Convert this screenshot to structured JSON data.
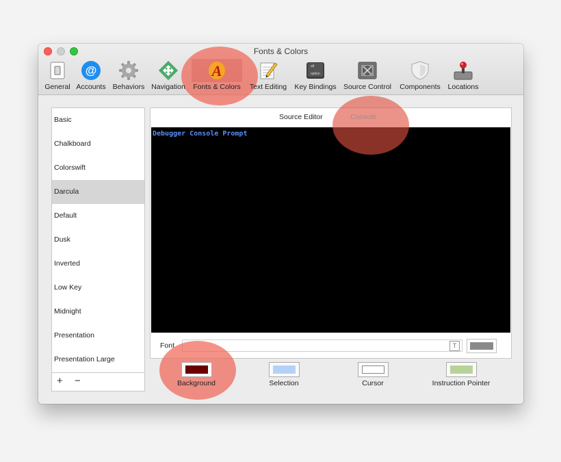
{
  "window": {
    "title": "Fonts & Colors"
  },
  "toolbar": {
    "items": [
      {
        "label": "General",
        "icon": "general-switch-icon"
      },
      {
        "label": "Accounts",
        "icon": "at-sign-icon"
      },
      {
        "label": "Behaviors",
        "icon": "gear-icon"
      },
      {
        "label": "Navigation",
        "icon": "crosshair-arrows-icon"
      },
      {
        "label": "Fonts & Colors",
        "icon": "font-a-icon"
      },
      {
        "label": "Text Editing",
        "icon": "notepad-pencil-icon"
      },
      {
        "label": "Key Bindings",
        "icon": "option-key-icon"
      },
      {
        "label": "Source Control",
        "icon": "vault-icon"
      },
      {
        "label": "Components",
        "icon": "shield-icon"
      },
      {
        "label": "Locations",
        "icon": "joystick-icon"
      }
    ],
    "selected": "Fonts & Colors"
  },
  "themes": {
    "items": [
      "Basic",
      "Chalkboard",
      "Colorswift",
      "Darcula",
      "Default",
      "Dusk",
      "Inverted",
      "Low Key",
      "Midnight",
      "Presentation",
      "Presentation Large"
    ],
    "selected": "Darcula",
    "add_symbol": "+",
    "remove_symbol": "−"
  },
  "editor": {
    "tabs": [
      "Source Editor",
      "Console"
    ],
    "active_tab": "Console",
    "console_prompt": "Debugger Console Prompt",
    "font_label": "Font",
    "font_value": ""
  },
  "swatches": [
    {
      "label": "Background",
      "color": "#6b0000"
    },
    {
      "label": "Selection",
      "color": "#b4d2f8"
    },
    {
      "label": "Cursor",
      "color": "#ffffff"
    },
    {
      "label": "Instruction Pointer",
      "color": "#b8d39a"
    }
  ],
  "colors": {
    "highlight": "#f05f50",
    "console_background": "#000000",
    "prompt_text": "#5b8ff9",
    "font_color_swatch": "#8a8a8a"
  }
}
